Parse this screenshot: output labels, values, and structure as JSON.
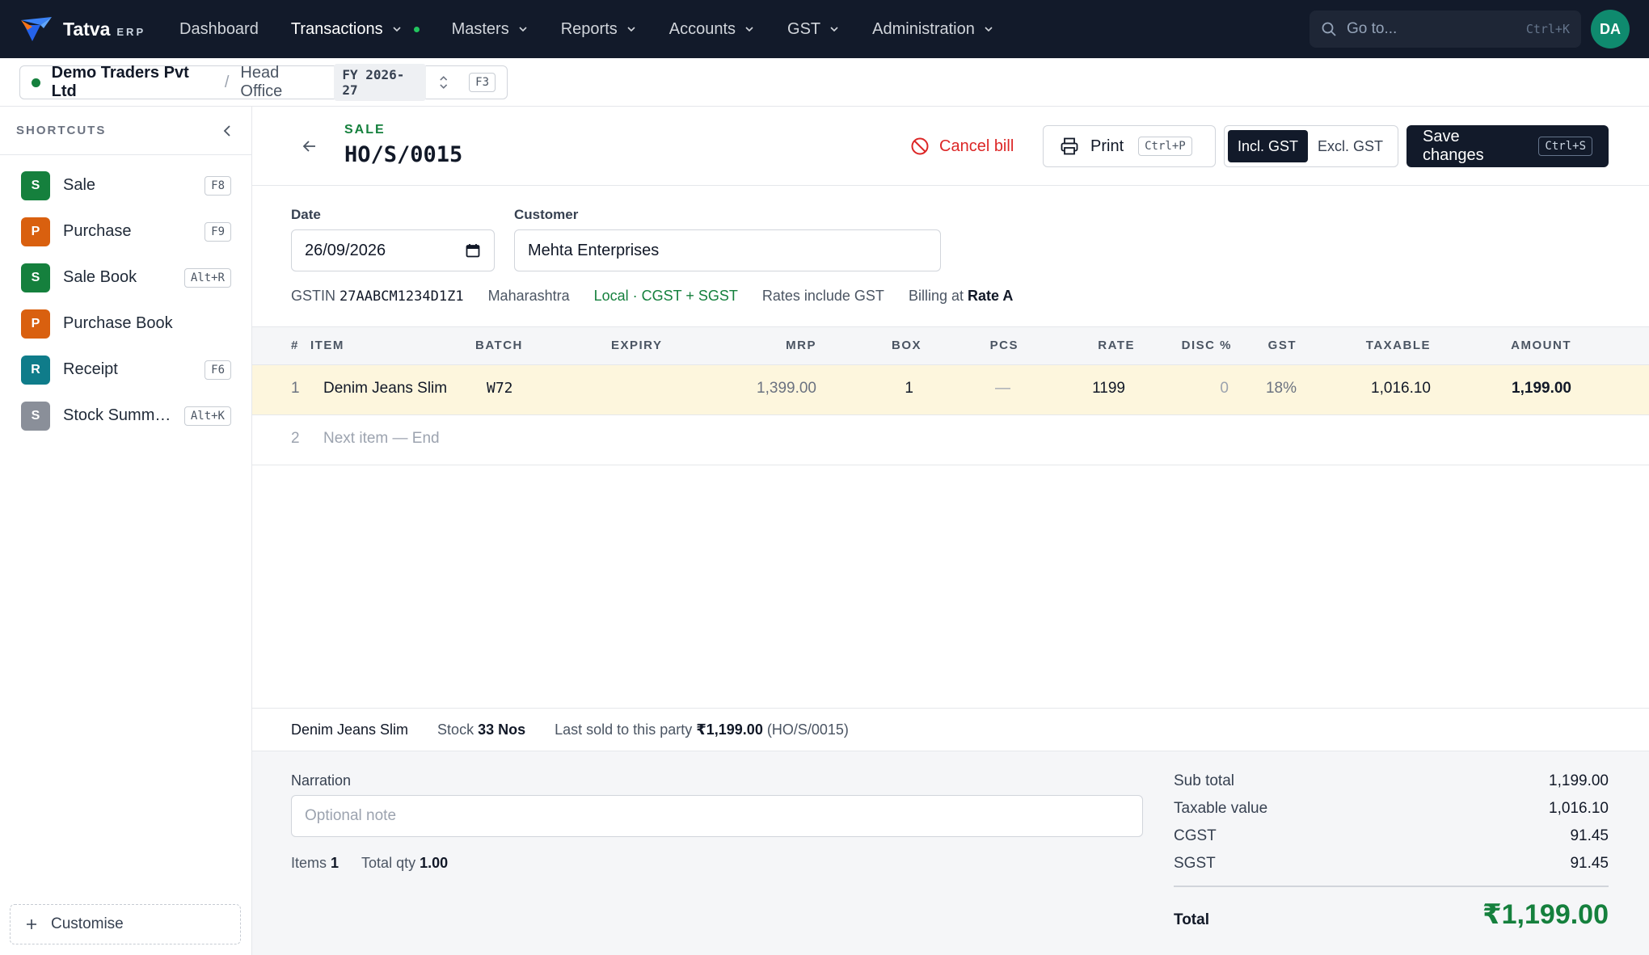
{
  "brand": {
    "name": "Tatva",
    "sub": "ERP"
  },
  "nav": {
    "items": [
      {
        "label": "Dashboard"
      },
      {
        "label": "Transactions"
      },
      {
        "label": "Masters"
      },
      {
        "label": "Reports"
      },
      {
        "label": "Accounts"
      },
      {
        "label": "GST"
      },
      {
        "label": "Administration"
      }
    ],
    "goto_placeholder": "Go to...",
    "goto_shortcut": "Ctrl+K",
    "avatar": "DA"
  },
  "context": {
    "company": "Demo Traders Pvt Ltd",
    "separator": "/",
    "branch": "Head Office",
    "fy": "FY 2026-27",
    "shortcut": "F3"
  },
  "sidebar": {
    "title": "SHORTCUTS",
    "items": [
      {
        "badge": "S",
        "label": "Sale",
        "key": "F8",
        "color": "#15803d"
      },
      {
        "badge": "P",
        "label": "Purchase",
        "key": "F9",
        "color": "#d9600f"
      },
      {
        "badge": "S",
        "label": "Sale Book",
        "key": "Alt+R",
        "color": "#15803d"
      },
      {
        "badge": "P",
        "label": "Purchase Book",
        "key": "",
        "color": "#d9600f"
      },
      {
        "badge": "R",
        "label": "Receipt",
        "key": "F6",
        "color": "#0f7c8a"
      },
      {
        "badge": "S",
        "label": "Stock Summary",
        "key": "Alt+K",
        "color": "#8a8f99"
      }
    ],
    "customise": "Customise"
  },
  "header": {
    "doc_type": "SALE",
    "doc_no": "HO/S/0015",
    "cancel_label": "Cancel bill",
    "print_label": "Print",
    "print_key": "Ctrl+P",
    "gst_incl": "Incl. GST",
    "gst_excl": "Excl. GST",
    "save_label": "Save changes",
    "save_key": "Ctrl+S"
  },
  "form": {
    "date_label": "Date",
    "date_value": "26/09/2026",
    "customer_label": "Customer",
    "customer_value": "Mehta Enterprises",
    "gstin_label": "GSTIN",
    "gstin": "27AABCM1234D1Z1",
    "state": "Maharashtra",
    "tax_mode": "Local · CGST + SGST",
    "rates_note": "Rates include GST",
    "billing_label": "Billing at",
    "billing_rate": "Rate A"
  },
  "table": {
    "headers": [
      "#",
      "ITEM",
      "BATCH",
      "EXPIRY",
      "MRP",
      "BOX",
      "PCS",
      "RATE",
      "DISC %",
      "GST",
      "TAXABLE",
      "AMOUNT"
    ],
    "rows": [
      {
        "no": "1",
        "item": "Denim Jeans Slim",
        "batch": "W72",
        "expiry": "",
        "mrp": "1,399.00",
        "box": "1",
        "pcs": "—",
        "rate": "1199",
        "disc": "0",
        "gst": "18%",
        "taxable": "1,016.10",
        "amount": "1,199.00"
      }
    ],
    "next_no": "2",
    "next_placeholder": "Next item — End"
  },
  "info": {
    "item": "Denim Jeans Slim",
    "stock_label": "Stock",
    "stock_value": "33 Nos",
    "last_sold_label": "Last sold to this party",
    "last_sold_value": "₹1,199.00",
    "last_sold_ref": "(HO/S/0015)"
  },
  "footer": {
    "narration_label": "Narration",
    "narration_placeholder": "Optional note",
    "items_label": "Items",
    "items_value": "1",
    "qty_label": "Total qty",
    "qty_value": "1.00",
    "subtotal_label": "Sub total",
    "subtotal": "1,199.00",
    "taxable_label": "Taxable value",
    "taxable": "1,016.10",
    "cgst_label": "CGST",
    "cgst": "91.45",
    "sgst_label": "SGST",
    "sgst": "91.45",
    "total_label": "Total",
    "total": "₹1,199.00"
  }
}
